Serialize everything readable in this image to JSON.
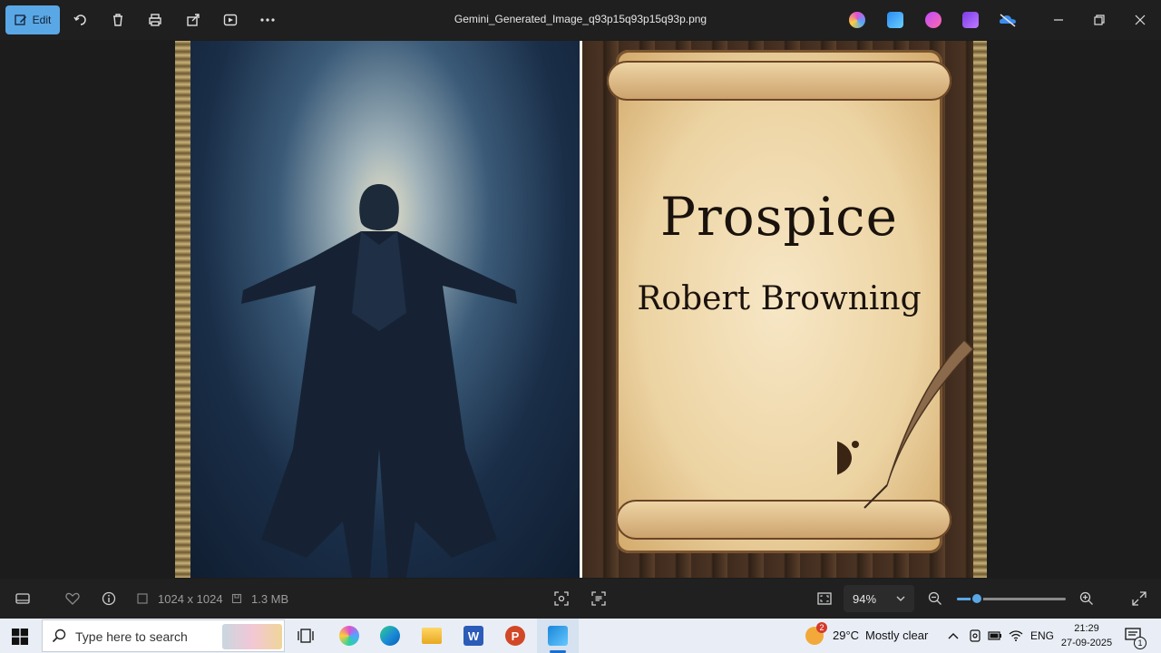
{
  "titlebar": {
    "edit_label": "Edit",
    "filename": "Gemini_Generated_Image_q93p15q93p15q93p.png",
    "toolbar_icons": [
      "rotate-icon",
      "delete-icon",
      "print-icon",
      "share-icon",
      "slideshow-icon",
      "more-icon"
    ],
    "app_icons": [
      "copilot-icon",
      "paint-icon",
      "designer-icon",
      "clipchamp-icon",
      "onedrive-icon"
    ]
  },
  "image": {
    "poem_title": "Prospice",
    "poem_author": "Robert Browning"
  },
  "bottombar": {
    "dimensions": "1024 x 1024",
    "filesize": "1.3 MB",
    "zoom": "94%",
    "zoom_level": 0.18
  },
  "taskbar": {
    "search_placeholder": "Type here to search",
    "weather_badge": "2",
    "weather": "29°C",
    "weather_desc": "Mostly clear",
    "language": "ENG",
    "time": "21:29",
    "date": "27-09-2025",
    "notif_count": "1"
  },
  "colors": {
    "accent": "#5aa7e6",
    "titlebar_bg": "#1f1f1f",
    "taskbar_bg": "#e9eef6"
  }
}
